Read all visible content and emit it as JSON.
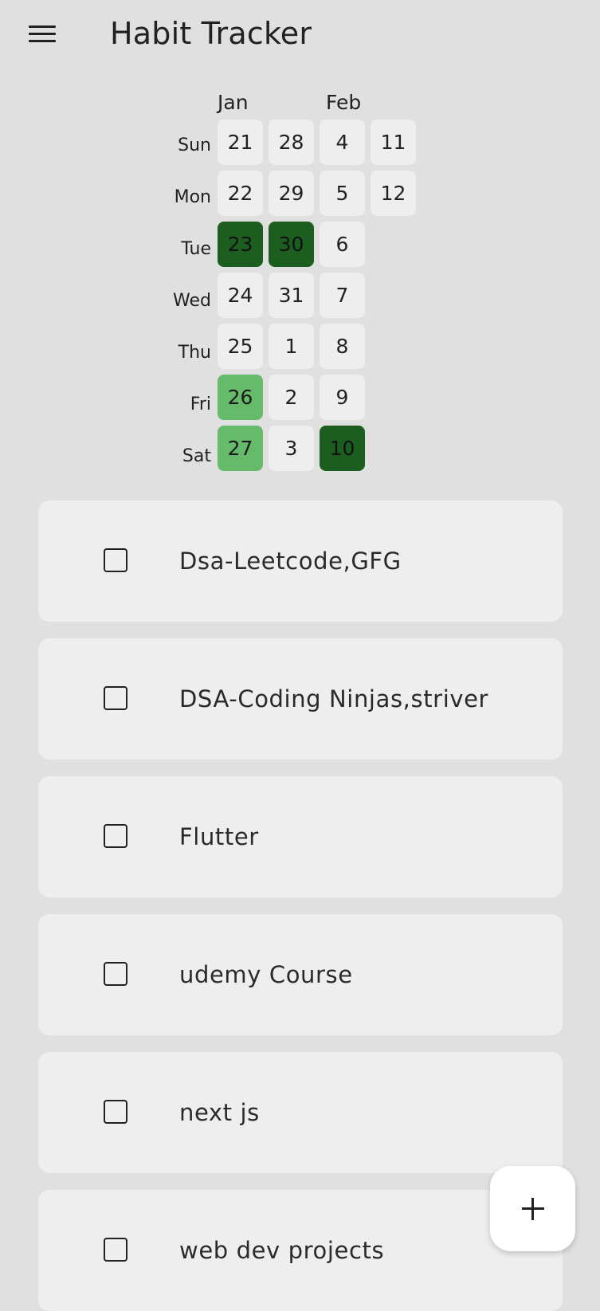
{
  "app": {
    "title": "Habit Tracker",
    "menu_icon": "hamburger-menu-icon"
  },
  "heatmap": {
    "months": [
      "Jan",
      "Feb"
    ],
    "day_labels": [
      "Sun",
      "Mon",
      "Tue",
      "Wed",
      "Thu",
      "Fri",
      "Sat"
    ],
    "weeks": [
      [
        "21",
        "22",
        "23",
        "24",
        "25",
        "26",
        "27"
      ],
      [
        "28",
        "29",
        "30",
        "31",
        "1",
        "2",
        "3"
      ],
      [
        "4",
        "5",
        "6",
        "7",
        "8",
        "9",
        "10"
      ],
      [
        "11",
        "12",
        "",
        "",
        "",
        "",
        ""
      ]
    ],
    "intensity": [
      [
        "none",
        "none",
        "dark",
        "none",
        "none",
        "light",
        "light"
      ],
      [
        "none",
        "none",
        "dark",
        "none",
        "none",
        "none",
        "none"
      ],
      [
        "none",
        "none",
        "none",
        "none",
        "none",
        "none",
        "dark"
      ],
      [
        "none",
        "none",
        "",
        "",
        "",
        "",
        ""
      ]
    ],
    "colors": {
      "empty": "#eeeeee",
      "light": "#66bb6a",
      "dark": "#1b5e20"
    }
  },
  "habits": [
    {
      "name": "Dsa-Leetcode,GFG",
      "completed": false
    },
    {
      "name": "DSA-Coding Ninjas,striver",
      "completed": false
    },
    {
      "name": "Flutter",
      "completed": false
    },
    {
      "name": "udemy Course",
      "completed": false
    },
    {
      "name": "next js",
      "completed": false
    },
    {
      "name": "web dev projects",
      "completed": false
    }
  ],
  "fab": {
    "icon": "plus-icon"
  }
}
